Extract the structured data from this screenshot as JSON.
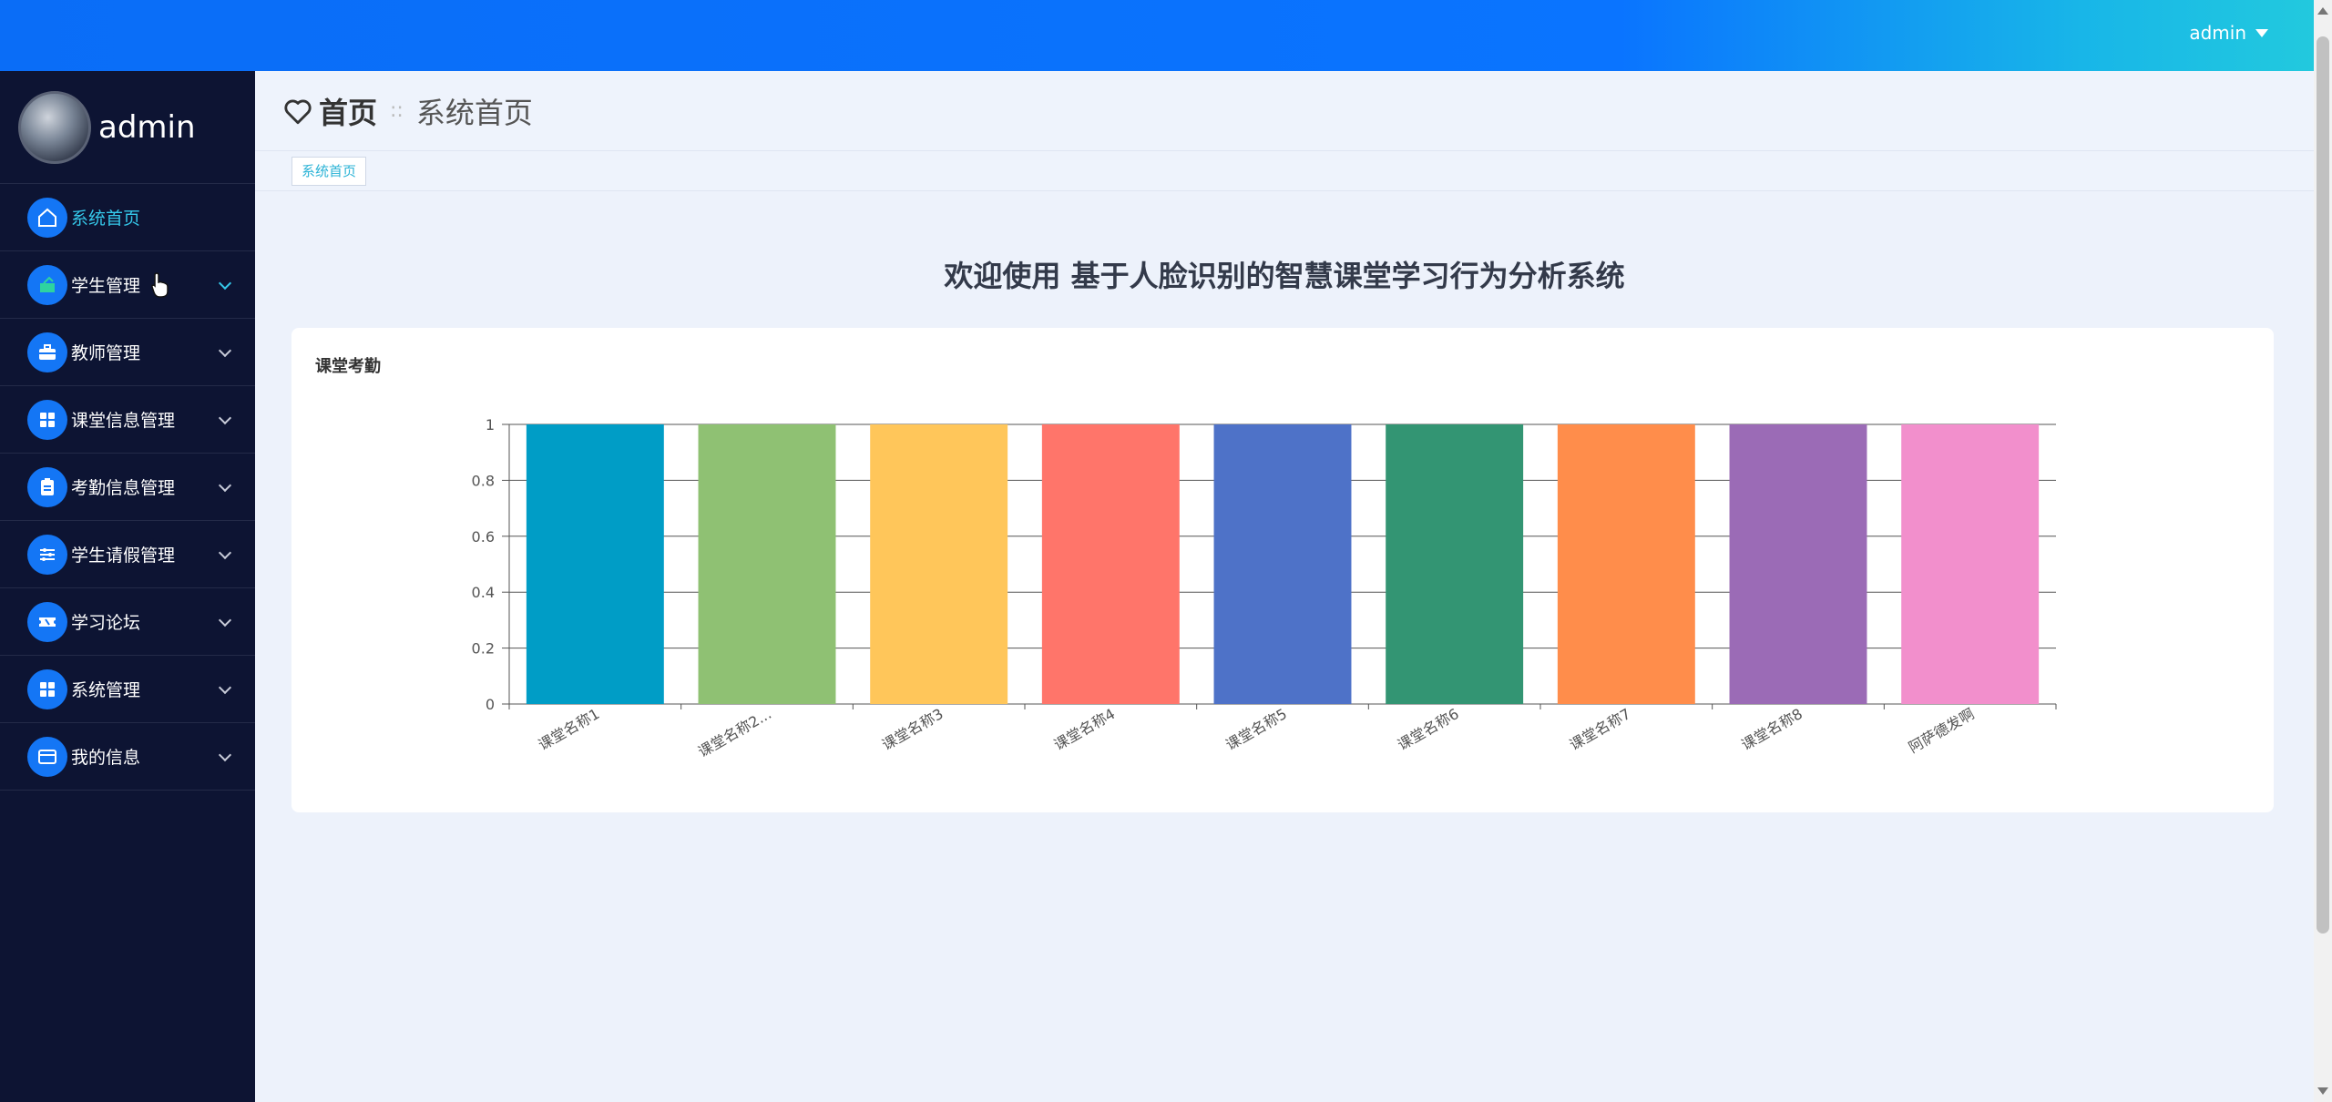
{
  "header": {
    "user": "admin"
  },
  "sidebar": {
    "profile_name": "admin",
    "items": [
      {
        "label": "系统首页",
        "icon": "home-icon",
        "expandable": false
      },
      {
        "label": "学生管理",
        "icon": "student-icon",
        "expandable": true
      },
      {
        "label": "教师管理",
        "icon": "briefcase-icon",
        "expandable": true
      },
      {
        "label": "课堂信息管理",
        "icon": "grid-icon",
        "expandable": true
      },
      {
        "label": "考勤信息管理",
        "icon": "clipboard-icon",
        "expandable": true
      },
      {
        "label": "学生请假管理",
        "icon": "sliders-icon",
        "expandable": true
      },
      {
        "label": "学习论坛",
        "icon": "ticket-icon",
        "expandable": true
      },
      {
        "label": "系统管理",
        "icon": "grid-icon",
        "expandable": true
      },
      {
        "label": "我的信息",
        "icon": "card-icon",
        "expandable": true
      }
    ]
  },
  "breadcrumb": {
    "home": "首页",
    "current": "系统首页"
  },
  "tabs": [
    {
      "label": "系统首页"
    }
  ],
  "welcome": "欢迎使用 基于人脸识别的智慧课堂学习行为分析系统",
  "card": {
    "title": "课堂考勤"
  },
  "chart_data": {
    "type": "bar",
    "categories": [
      "课堂名称1",
      "课堂名称2...",
      "课堂名称3",
      "课堂名称4",
      "课堂名称5",
      "课堂名称6",
      "课堂名称7",
      "课堂名称8",
      "阿萨德发啊"
    ],
    "values": [
      1,
      1,
      1,
      1,
      1,
      1,
      1,
      1,
      1
    ],
    "colors": [
      "#009dc6",
      "#8fc173",
      "#ffc65a",
      "#ff756a",
      "#4e72c8",
      "#339573",
      "#ff8d4b",
      "#9b6bb6",
      "#f28fcc"
    ],
    "ylim": [
      0,
      1
    ],
    "yticks": [
      "0",
      "0.2",
      "0.4",
      "0.6",
      "0.8",
      "1"
    ],
    "grid": true
  }
}
